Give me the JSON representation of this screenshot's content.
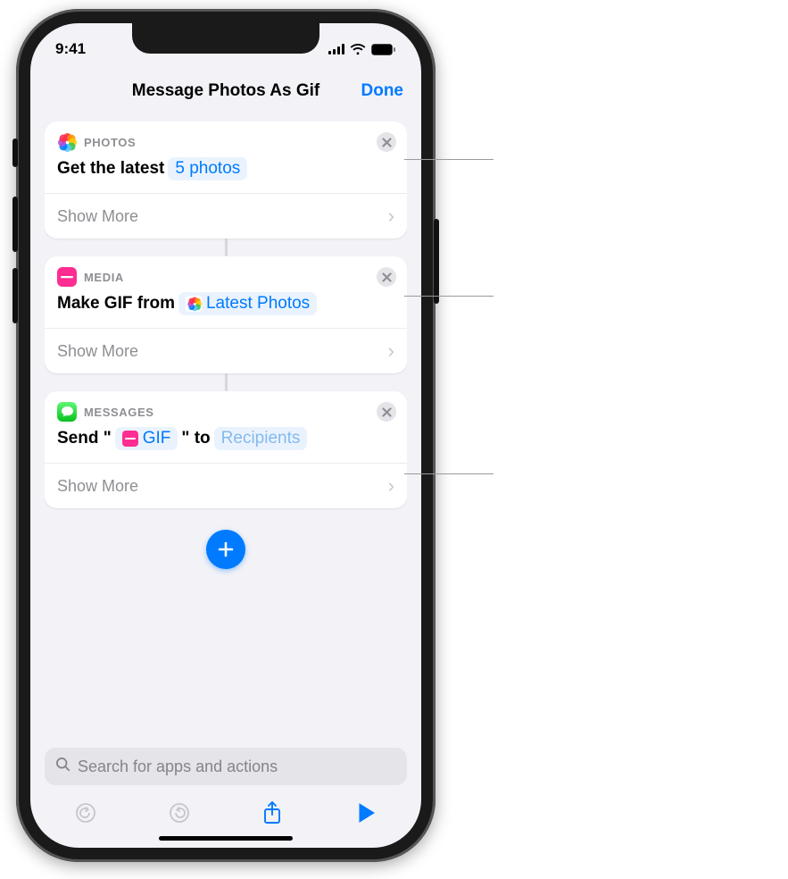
{
  "status": {
    "time": "9:41"
  },
  "nav": {
    "title": "Message Photos As Gif",
    "done": "Done"
  },
  "actions": [
    {
      "id": "photos",
      "app_label": "PHOTOS",
      "icon": "photos-icon",
      "close_icon": "close-icon",
      "line_pre": "Get the latest",
      "tokens": [
        {
          "text": "5 photos",
          "icon": null,
          "placeholder": false
        }
      ],
      "show_more": "Show More"
    },
    {
      "id": "media",
      "app_label": "MEDIA",
      "icon": "media-icon",
      "close_icon": "close-icon",
      "line_pre": "Make GIF from",
      "tokens": [
        {
          "text": "Latest Photos",
          "icon": "photos-mini-icon",
          "placeholder": false
        }
      ],
      "show_more": "Show More"
    },
    {
      "id": "messages",
      "app_label": "MESSAGES",
      "icon": "messages-icon",
      "close_icon": "close-icon",
      "line_pre": "Send \"",
      "tokens": [
        {
          "text": "GIF",
          "icon": "media-mini-icon",
          "placeholder": false
        }
      ],
      "line_mid": "\" to",
      "tokens2": [
        {
          "text": "Recipients",
          "icon": null,
          "placeholder": true
        }
      ],
      "show_more": "Show More"
    }
  ],
  "add_button": {
    "label": "Add Action"
  },
  "search": {
    "placeholder": "Search for apps and actions"
  },
  "toolbar": {
    "undo": "undo-icon",
    "redo": "redo-icon",
    "share": "share-icon",
    "play": "play-icon"
  }
}
